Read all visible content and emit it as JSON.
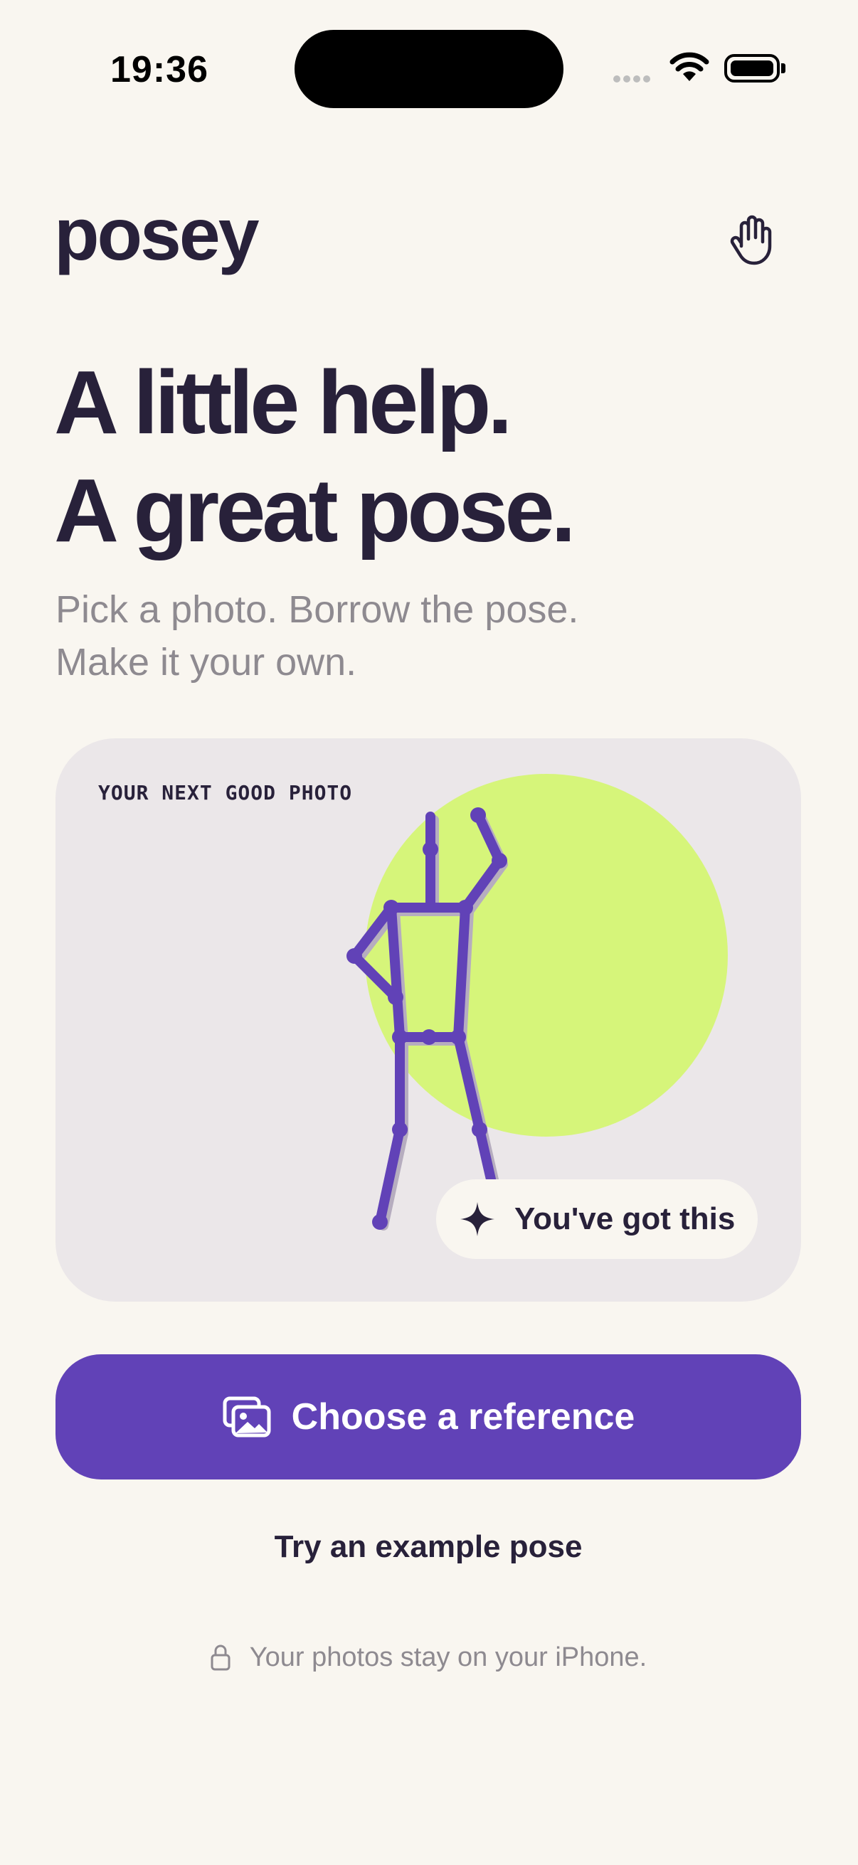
{
  "status_bar": {
    "time": "19:36",
    "icons": [
      "cellular-dots-icon",
      "wifi-icon",
      "battery-icon"
    ]
  },
  "header": {
    "logo": "posey",
    "action_icon": "hand-icon"
  },
  "hero": {
    "headline_line1": "A little help.",
    "headline_line2": "A great pose.",
    "subtitle_line1": "Pick a photo. Borrow the pose.",
    "subtitle_line2": "Make it your own."
  },
  "card": {
    "label": "YOUR NEXT GOOD PHOTO",
    "toast_icon": "sparkle-icon",
    "toast_text": "You've got this"
  },
  "actions": {
    "primary_label": "Choose a reference",
    "primary_icon": "photos-icon",
    "secondary_label": "Try an example pose"
  },
  "footer": {
    "privacy_icon": "lock-icon",
    "privacy_text": "Your photos stay on your iPhone."
  },
  "colors": {
    "background": "#F9F6F0",
    "ink": "#28213A",
    "accent_purple": "#6142B7",
    "accent_lime": "#D6F57A",
    "card_bg": "#EBE7E9",
    "muted_text": "#8E8A90"
  }
}
